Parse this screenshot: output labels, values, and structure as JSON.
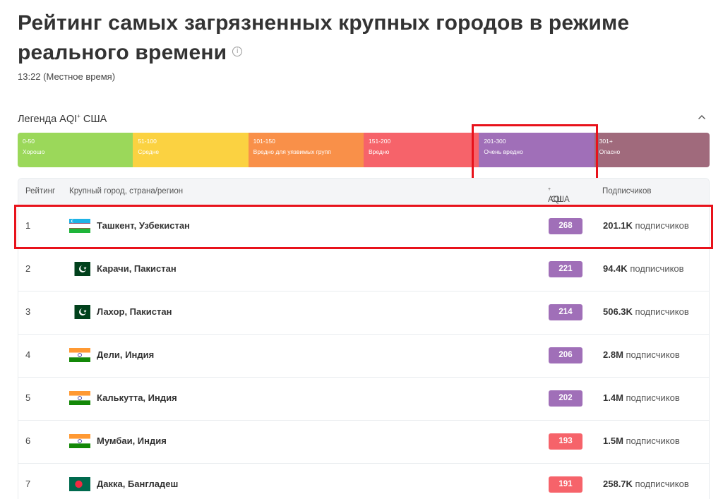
{
  "page": {
    "title": "Рейтинг самых загрязненных крупных городов в режиме реального времени",
    "time": "13:22 (Местное время)"
  },
  "legend": {
    "title": "Легенда AQI",
    "title_sup": "+",
    "title_suffix": " США",
    "segments": [
      {
        "range": "0-50",
        "label": "Хорошо",
        "color": "#9bd85a"
      },
      {
        "range": "51-100",
        "label": "Средне",
        "color": "#fbd241"
      },
      {
        "range": "101-150",
        "label": "Вредно для уязвимых групп",
        "color": "#f99049"
      },
      {
        "range": "151-200",
        "label": "Вредно",
        "color": "#f6636a"
      },
      {
        "range": "201-300",
        "label": "Очень вредно",
        "color": "#a06fb8"
      },
      {
        "range": "301+",
        "label": "Опасно",
        "color": "#a06a7c"
      }
    ]
  },
  "table": {
    "headers": {
      "rank": "Рейтинг",
      "city": "Крупный город, страна/регион",
      "aqi": "AQI",
      "aqi_sup": "+",
      "aqi_suffix": " США",
      "subs": "Подписчиков"
    },
    "rows": [
      {
        "rank": "1",
        "flag": "uzbekistan-flag-icon",
        "city": "Ташкент, Узбекистан",
        "aqi": "268",
        "aqi_color": "#a06fb8",
        "subs_count": "201.1K",
        "subs_text": " подписчиков"
      },
      {
        "rank": "2",
        "flag": "pakistan-flag-icon",
        "city": "Карачи, Пакистан",
        "aqi": "221",
        "aqi_color": "#a06fb8",
        "subs_count": "94.4K",
        "subs_text": " подписчиков"
      },
      {
        "rank": "3",
        "flag": "pakistan-flag-icon",
        "city": "Лахор, Пакистан",
        "aqi": "214",
        "aqi_color": "#a06fb8",
        "subs_count": "506.3K",
        "subs_text": " подписчиков"
      },
      {
        "rank": "4",
        "flag": "india-flag-icon",
        "city": "Дели, Индия",
        "aqi": "206",
        "aqi_color": "#a06fb8",
        "subs_count": "2.8M",
        "subs_text": " подписчиков"
      },
      {
        "rank": "5",
        "flag": "india-flag-icon",
        "city": "Калькутта, Индия",
        "aqi": "202",
        "aqi_color": "#a06fb8",
        "subs_count": "1.4M",
        "subs_text": " подписчиков"
      },
      {
        "rank": "6",
        "flag": "india-flag-icon",
        "city": "Мумбаи, Индия",
        "aqi": "193",
        "aqi_color": "#f6636a",
        "subs_count": "1.5M",
        "subs_text": " подписчиков"
      },
      {
        "rank": "7",
        "flag": "bangladesh-flag-icon",
        "city": "Дакка, Бангладеш",
        "aqi": "191",
        "aqi_color": "#f6636a",
        "subs_count": "258.7K",
        "subs_text": " подписчиков"
      }
    ]
  },
  "colors": {
    "highlight": "#e8121b",
    "very_unhealthy": "#a06fb8",
    "unhealthy": "#f6636a"
  }
}
